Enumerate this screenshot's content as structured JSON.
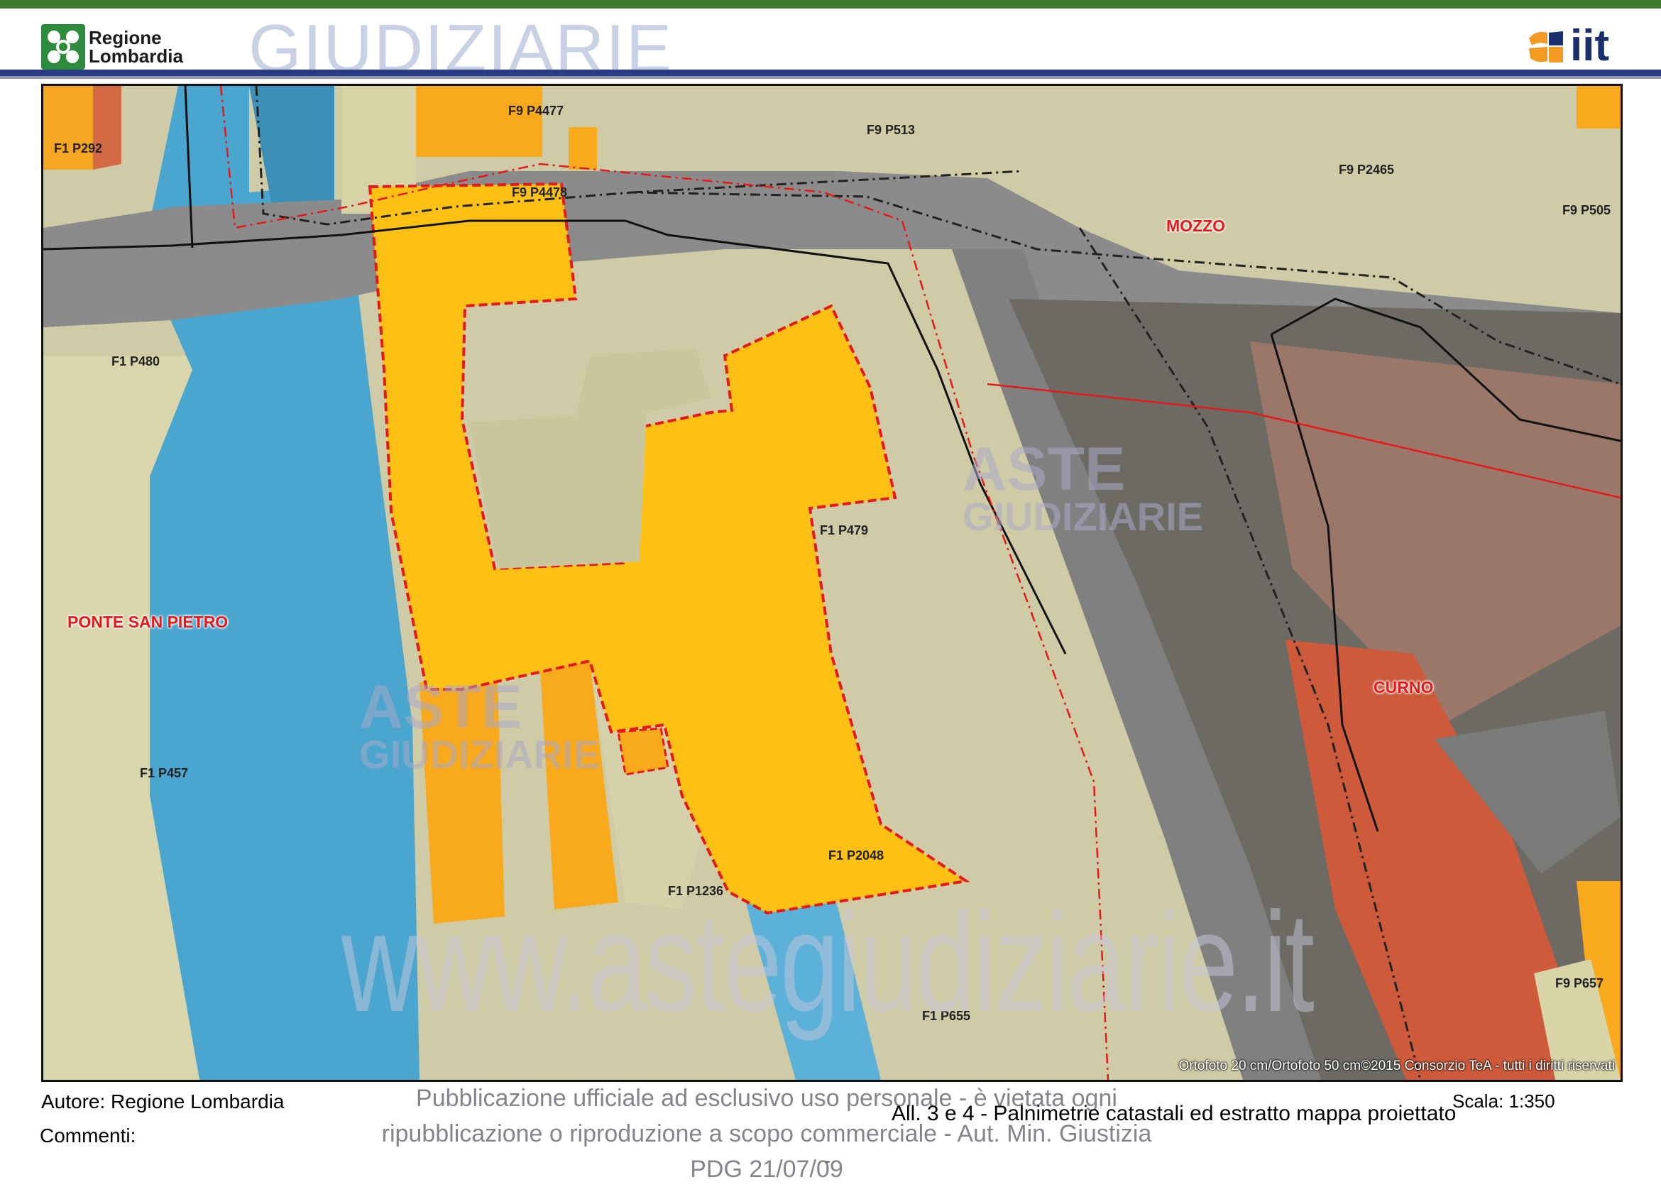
{
  "header": {
    "region_logo_text": [
      "Regione",
      "Lombardia"
    ],
    "watermark_text": "GIUDIZIARIE",
    "partner_logo_text": "iit"
  },
  "map": {
    "parcels": [
      {
        "label": "F1 P292"
      },
      {
        "label": "F9 P4477"
      },
      {
        "label": "F9 P4478"
      },
      {
        "label": "F9 P513"
      },
      {
        "label": "F9 P2465"
      },
      {
        "label": "F9 P505"
      },
      {
        "label": "F1 P480"
      },
      {
        "label": "F1 P479"
      },
      {
        "label": "F1 P457"
      },
      {
        "label": "F1 P1236"
      },
      {
        "label": "F1 P2048"
      },
      {
        "label": "F1 P655"
      },
      {
        "label": "F9 P657"
      }
    ],
    "municipalities": [
      {
        "name": "MOZZO"
      },
      {
        "name": "PONTE SAN PIETRO"
      },
      {
        "name": "CURNO"
      }
    ],
    "copyright": "Ortofoto 20 cm/Ortofoto 50 cm©2015 Consorzio TeA - tutti i diritti riservati",
    "watermarks": {
      "aste": "ASTE",
      "giudiziarie": "GIUDIZIARIE",
      "site": "www.astegiudiziarie.it"
    },
    "colors": {
      "highlight_parcel": "#fcc114",
      "adjacent_parcel": "#f9a91c",
      "water_blue": "#4aa6cf",
      "road_gray": "#868686",
      "boundary_red": "#e41a1a"
    }
  },
  "footer": {
    "author": "Autore: Regione Lombardia",
    "comments": "Commenti:",
    "scale": "Scala:  1:350",
    "caption": "All. 3 e 4 - Palnimetrie catastali ed estratto mappa proiettato",
    "notice_line1": "Pubblicazione ufficiale ad esclusivo uso personale - è vietata ogni",
    "notice_line2": "ripubblicazione o riproduzione a scopo commerciale - Aut. Min. Giustizia PDG 21/07/09",
    "dash": "-"
  }
}
